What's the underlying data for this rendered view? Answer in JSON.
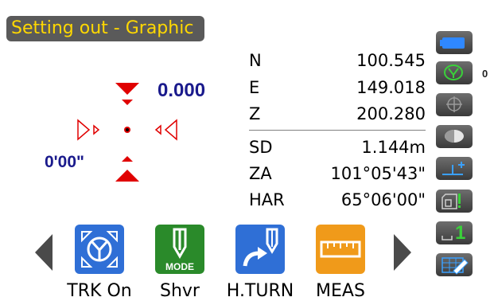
{
  "title": "Setting out - Graphic",
  "guidance": {
    "distance_value": "0.000",
    "angle_value": "0'00\""
  },
  "data_rows": [
    {
      "label": "N",
      "value": "100.545"
    },
    {
      "label": "E",
      "value": "149.018"
    },
    {
      "label": "Z",
      "value": "200.280"
    },
    {
      "label": "SD",
      "value": "1.144m"
    },
    {
      "label": "ZA",
      "value": "101°05'43\""
    },
    {
      "label": "HAR",
      "value": "65°06'00\""
    }
  ],
  "sidebar": {
    "target_count": "0",
    "reflector_index": "1"
  },
  "function_keys": [
    {
      "label": "TRK On",
      "icon": "tracking-icon",
      "color": "#2f6fd6"
    },
    {
      "label": "Shvr",
      "icon": "shovel-mode-icon",
      "color": "#2a8a2a",
      "sublabel": "MODE"
    },
    {
      "label": "H.TURN",
      "icon": "horizontal-turn-icon",
      "color": "#2f6fd6"
    },
    {
      "label": "MEAS",
      "icon": "measure-icon",
      "color": "#f09a1a"
    }
  ],
  "colors": {
    "title_bg": "#5a5a5a",
    "title_text": "#ffd800",
    "direction_arrows": "#e00000",
    "value_text": "#1a1a8c"
  }
}
